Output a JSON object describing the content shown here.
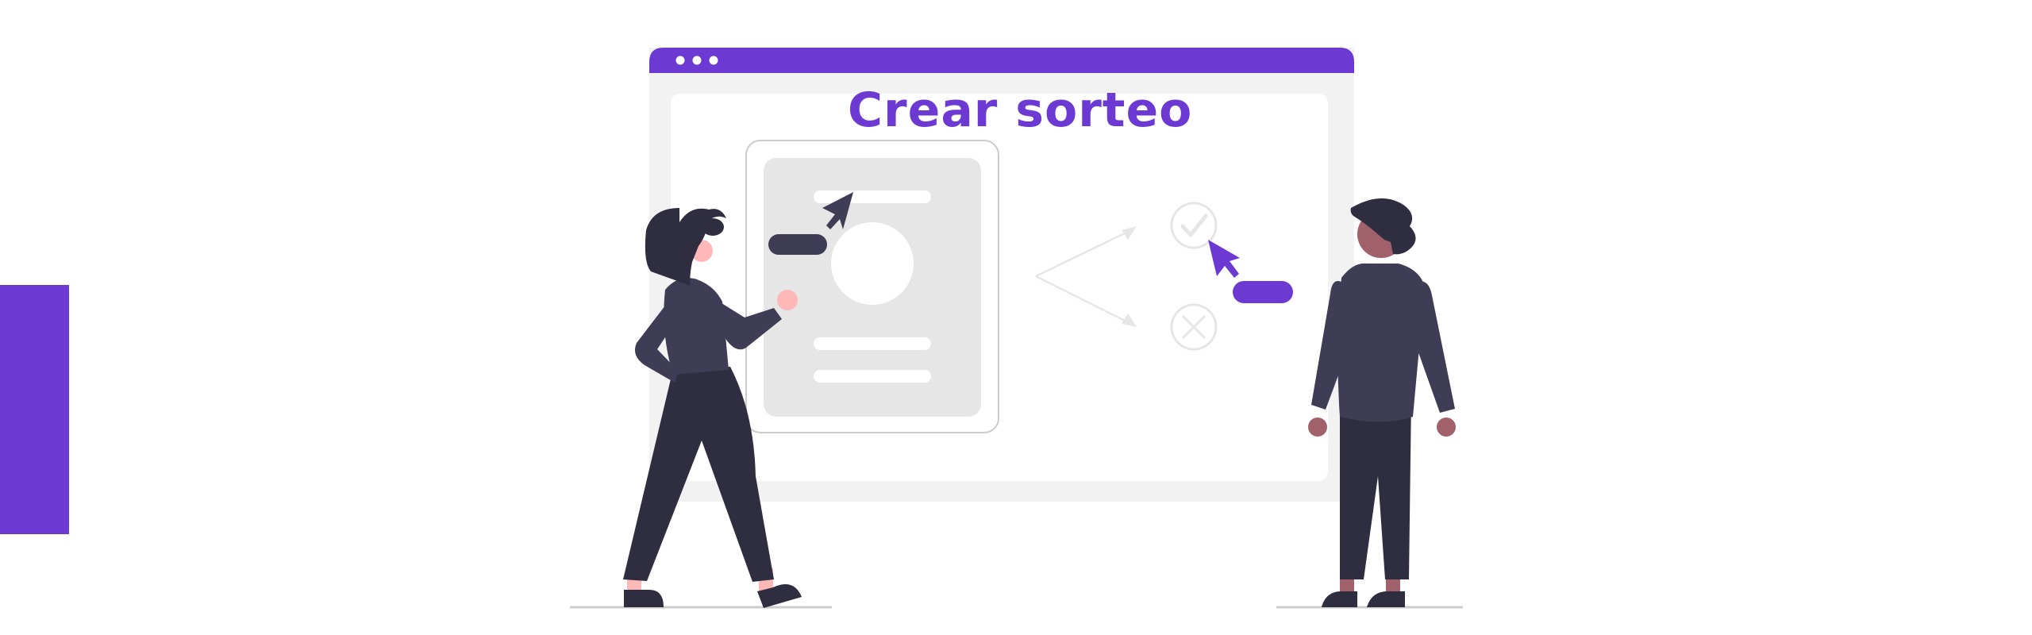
{
  "title": "Crear sorteo",
  "colors": {
    "accent": "#6c3ad2",
    "panel_light": "#f2f2f2",
    "panel_mid": "#e6e6e6",
    "dark": "#3f3d56",
    "darker": "#2f2e41",
    "skin_light": "#ffb8b8",
    "skin_dark": "#a0616a",
    "outline": "#cccccc"
  },
  "icons": {
    "browser_dots": "window-dots-icon",
    "check": "check-circle-icon",
    "cross": "x-circle-icon",
    "cursor": "cursor-arrow-icon",
    "image_placeholder": "image-placeholder-icon"
  }
}
